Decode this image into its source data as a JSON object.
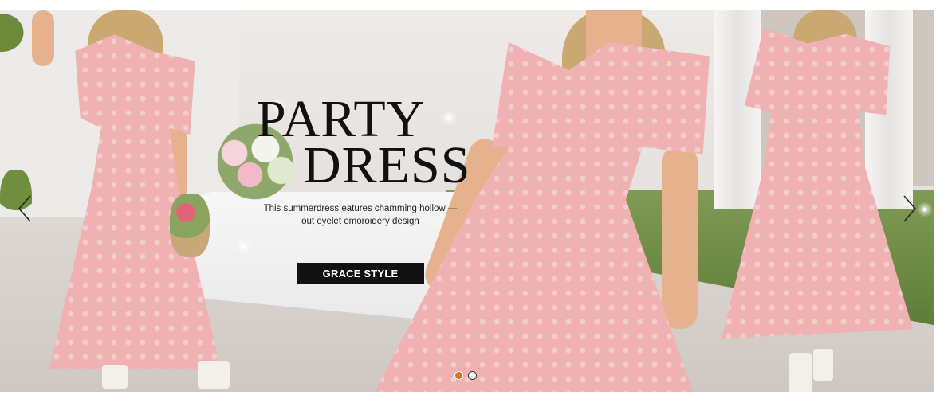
{
  "banner": {
    "headline_line1": "PARTY",
    "headline_line2": "DRESS",
    "subtitle_line1": "This summerdress eatures chamming hollow —",
    "subtitle_line2": "out eyelet emoroidery design",
    "cta_label": "GRACE STYLE",
    "prev_icon": "chevron-left-icon",
    "next_icon": "chevron-right-icon"
  },
  "carousel": {
    "slide_count": 2,
    "active_index": 0,
    "active_color": "#d9742e"
  },
  "colors": {
    "dress": "#efb1b2",
    "button_bg": "#111111",
    "button_text": "#ffffff"
  }
}
